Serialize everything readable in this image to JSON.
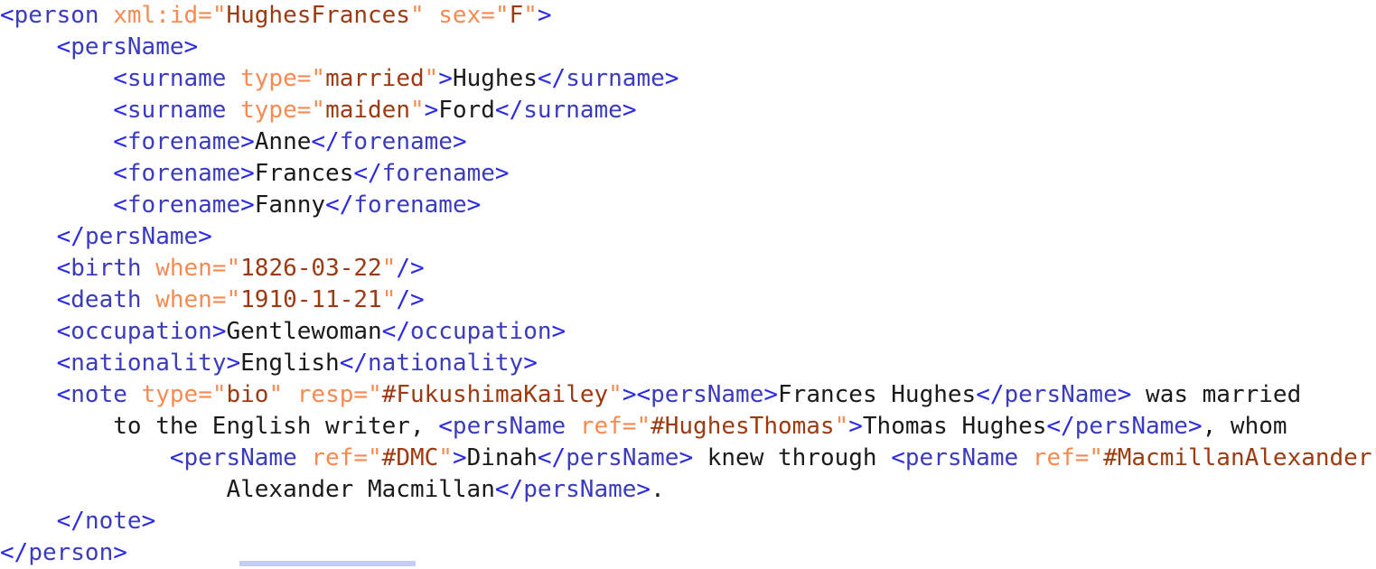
{
  "document": {
    "kind": "xml-source",
    "language": "XML / TEI",
    "root_element": "person",
    "colors": {
      "background": "#ffffff",
      "bracket": "#2a2ae6",
      "element_name": "#3b3bbd",
      "attribute_name": "#f58b52",
      "attribute_value": "#9c3a12",
      "text_content": "#1a1a1a",
      "bottom_bar": "#c5cdf5"
    }
  },
  "record": {
    "xml_id": "HughesFrances",
    "sex": "F",
    "surname_married": "Hughes",
    "surname_maiden": "Ford",
    "forenames": [
      "Anne",
      "Frances",
      "Fanny"
    ],
    "birth_when": "1826-03-22",
    "death_when": "1910-11-21",
    "occupation": "Gentlewoman",
    "nationality": "English",
    "note_type": "bio",
    "note_resp": "#FukushimaKailey",
    "note_refs": [
      "#HughesThomas",
      "#DMC",
      "#MacmillanAlexander"
    ]
  },
  "lines": [
    {
      "id": "line-1",
      "indent": 0,
      "tokens": [
        {
          "t": "tag",
          "v": "<"
        },
        {
          "t": "name",
          "v": "person"
        },
        {
          "t": "text",
          "v": " "
        },
        {
          "t": "attr",
          "v": "xml:id"
        },
        {
          "t": "eq",
          "v": "="
        },
        {
          "t": "quote",
          "v": "\""
        },
        {
          "t": "value",
          "v": "HughesFrances"
        },
        {
          "t": "quote",
          "v": "\""
        },
        {
          "t": "text",
          "v": " "
        },
        {
          "t": "attr",
          "v": "sex"
        },
        {
          "t": "eq",
          "v": "="
        },
        {
          "t": "quote",
          "v": "\""
        },
        {
          "t": "value",
          "v": "F"
        },
        {
          "t": "quote",
          "v": "\""
        },
        {
          "t": "tag",
          "v": ">"
        }
      ]
    },
    {
      "id": "line-2",
      "indent": 1,
      "tokens": [
        {
          "t": "tag",
          "v": "<"
        },
        {
          "t": "name",
          "v": "persName"
        },
        {
          "t": "tag",
          "v": ">"
        }
      ]
    },
    {
      "id": "line-3",
      "indent": 2,
      "tokens": [
        {
          "t": "tag",
          "v": "<"
        },
        {
          "t": "name",
          "v": "surname"
        },
        {
          "t": "text",
          "v": " "
        },
        {
          "t": "attr",
          "v": "type"
        },
        {
          "t": "eq",
          "v": "="
        },
        {
          "t": "quote",
          "v": "\""
        },
        {
          "t": "value",
          "v": "married"
        },
        {
          "t": "quote",
          "v": "\""
        },
        {
          "t": "tag",
          "v": ">"
        },
        {
          "t": "text",
          "v": "Hughes"
        },
        {
          "t": "tag",
          "v": "</"
        },
        {
          "t": "name",
          "v": "surname"
        },
        {
          "t": "tag",
          "v": ">"
        }
      ]
    },
    {
      "id": "line-4",
      "indent": 2,
      "tokens": [
        {
          "t": "tag",
          "v": "<"
        },
        {
          "t": "name",
          "v": "surname"
        },
        {
          "t": "text",
          "v": " "
        },
        {
          "t": "attr",
          "v": "type"
        },
        {
          "t": "eq",
          "v": "="
        },
        {
          "t": "quote",
          "v": "\""
        },
        {
          "t": "value",
          "v": "maiden"
        },
        {
          "t": "quote",
          "v": "\""
        },
        {
          "t": "tag",
          "v": ">"
        },
        {
          "t": "text",
          "v": "Ford"
        },
        {
          "t": "tag",
          "v": "</"
        },
        {
          "t": "name",
          "v": "surname"
        },
        {
          "t": "tag",
          "v": ">"
        }
      ]
    },
    {
      "id": "line-5",
      "indent": 2,
      "tokens": [
        {
          "t": "tag",
          "v": "<"
        },
        {
          "t": "name",
          "v": "forename"
        },
        {
          "t": "tag",
          "v": ">"
        },
        {
          "t": "text",
          "v": "Anne"
        },
        {
          "t": "tag",
          "v": "</"
        },
        {
          "t": "name",
          "v": "forename"
        },
        {
          "t": "tag",
          "v": ">"
        }
      ]
    },
    {
      "id": "line-6",
      "indent": 2,
      "tokens": [
        {
          "t": "tag",
          "v": "<"
        },
        {
          "t": "name",
          "v": "forename"
        },
        {
          "t": "tag",
          "v": ">"
        },
        {
          "t": "text",
          "v": "Frances"
        },
        {
          "t": "tag",
          "v": "</"
        },
        {
          "t": "name",
          "v": "forename"
        },
        {
          "t": "tag",
          "v": ">"
        }
      ]
    },
    {
      "id": "line-7",
      "indent": 2,
      "tokens": [
        {
          "t": "tag",
          "v": "<"
        },
        {
          "t": "name",
          "v": "forename"
        },
        {
          "t": "tag",
          "v": ">"
        },
        {
          "t": "text",
          "v": "Fanny"
        },
        {
          "t": "tag",
          "v": "</"
        },
        {
          "t": "name",
          "v": "forename"
        },
        {
          "t": "tag",
          "v": ">"
        }
      ]
    },
    {
      "id": "line-8",
      "indent": 1,
      "tokens": [
        {
          "t": "tag",
          "v": "</"
        },
        {
          "t": "name",
          "v": "persName"
        },
        {
          "t": "tag",
          "v": ">"
        }
      ]
    },
    {
      "id": "line-9",
      "indent": 1,
      "tokens": [
        {
          "t": "tag",
          "v": "<"
        },
        {
          "t": "name",
          "v": "birth"
        },
        {
          "t": "text",
          "v": " "
        },
        {
          "t": "attr",
          "v": "when"
        },
        {
          "t": "eq",
          "v": "="
        },
        {
          "t": "quote",
          "v": "\""
        },
        {
          "t": "value",
          "v": "1826-03-22"
        },
        {
          "t": "quote",
          "v": "\""
        },
        {
          "t": "tag",
          "v": "/>"
        }
      ]
    },
    {
      "id": "line-10",
      "indent": 1,
      "tokens": [
        {
          "t": "tag",
          "v": "<"
        },
        {
          "t": "name",
          "v": "death"
        },
        {
          "t": "text",
          "v": " "
        },
        {
          "t": "attr",
          "v": "when"
        },
        {
          "t": "eq",
          "v": "="
        },
        {
          "t": "quote",
          "v": "\""
        },
        {
          "t": "value",
          "v": "1910-11-21"
        },
        {
          "t": "quote",
          "v": "\""
        },
        {
          "t": "tag",
          "v": "/>"
        }
      ]
    },
    {
      "id": "line-11",
      "indent": 1,
      "tokens": [
        {
          "t": "tag",
          "v": "<"
        },
        {
          "t": "name",
          "v": "occupation"
        },
        {
          "t": "tag",
          "v": ">"
        },
        {
          "t": "text",
          "v": "Gentlewoman"
        },
        {
          "t": "tag",
          "v": "</"
        },
        {
          "t": "name",
          "v": "occupation"
        },
        {
          "t": "tag",
          "v": ">"
        }
      ]
    },
    {
      "id": "line-12",
      "indent": 1,
      "tokens": [
        {
          "t": "tag",
          "v": "<"
        },
        {
          "t": "name",
          "v": "nationality"
        },
        {
          "t": "tag",
          "v": ">"
        },
        {
          "t": "text",
          "v": "English"
        },
        {
          "t": "tag",
          "v": "</"
        },
        {
          "t": "name",
          "v": "nationality"
        },
        {
          "t": "tag",
          "v": ">"
        }
      ]
    },
    {
      "id": "line-13",
      "indent": 1,
      "tokens": [
        {
          "t": "tag",
          "v": "<"
        },
        {
          "t": "name",
          "v": "note"
        },
        {
          "t": "text",
          "v": " "
        },
        {
          "t": "attr",
          "v": "type"
        },
        {
          "t": "eq",
          "v": "="
        },
        {
          "t": "quote",
          "v": "\""
        },
        {
          "t": "value",
          "v": "bio"
        },
        {
          "t": "quote",
          "v": "\""
        },
        {
          "t": "text",
          "v": " "
        },
        {
          "t": "attr",
          "v": "resp"
        },
        {
          "t": "eq",
          "v": "="
        },
        {
          "t": "quote",
          "v": "\""
        },
        {
          "t": "value",
          "v": "#FukushimaKailey"
        },
        {
          "t": "quote",
          "v": "\""
        },
        {
          "t": "tag",
          "v": ">"
        },
        {
          "t": "tag",
          "v": "<"
        },
        {
          "t": "name",
          "v": "persName"
        },
        {
          "t": "tag",
          "v": ">"
        },
        {
          "t": "text",
          "v": "Frances Hughes"
        },
        {
          "t": "tag",
          "v": "</"
        },
        {
          "t": "name",
          "v": "persName"
        },
        {
          "t": "tag",
          "v": ">"
        },
        {
          "t": "text",
          "v": " was married"
        }
      ]
    },
    {
      "id": "line-14",
      "indent": 2,
      "tokens": [
        {
          "t": "text",
          "v": "to the English writer, "
        },
        {
          "t": "tag",
          "v": "<"
        },
        {
          "t": "name",
          "v": "persName"
        },
        {
          "t": "text",
          "v": " "
        },
        {
          "t": "attr",
          "v": "ref"
        },
        {
          "t": "eq",
          "v": "="
        },
        {
          "t": "quote",
          "v": "\""
        },
        {
          "t": "value",
          "v": "#HughesThomas"
        },
        {
          "t": "quote",
          "v": "\""
        },
        {
          "t": "tag",
          "v": ">"
        },
        {
          "t": "text",
          "v": "Thomas Hughes"
        },
        {
          "t": "tag",
          "v": "</"
        },
        {
          "t": "name",
          "v": "persName"
        },
        {
          "t": "tag",
          "v": ">"
        },
        {
          "t": "text",
          "v": ", whom"
        }
      ]
    },
    {
      "id": "line-15",
      "indent": 3,
      "tokens": [
        {
          "t": "tag",
          "v": "<"
        },
        {
          "t": "name",
          "v": "persName"
        },
        {
          "t": "text",
          "v": " "
        },
        {
          "t": "attr",
          "v": "ref"
        },
        {
          "t": "eq",
          "v": "="
        },
        {
          "t": "quote",
          "v": "\""
        },
        {
          "t": "value",
          "v": "#DMC"
        },
        {
          "t": "quote",
          "v": "\""
        },
        {
          "t": "tag",
          "v": ">"
        },
        {
          "t": "text",
          "v": "Dinah"
        },
        {
          "t": "tag",
          "v": "</"
        },
        {
          "t": "name",
          "v": "persName"
        },
        {
          "t": "tag",
          "v": ">"
        },
        {
          "t": "text",
          "v": " knew through "
        },
        {
          "t": "tag",
          "v": "<"
        },
        {
          "t": "name",
          "v": "persName"
        },
        {
          "t": "text",
          "v": " "
        },
        {
          "t": "attr",
          "v": "ref"
        },
        {
          "t": "eq",
          "v": "="
        },
        {
          "t": "quote",
          "v": "\""
        },
        {
          "t": "value",
          "v": "#MacmillanAlexander"
        },
        {
          "t": "quote",
          "v": "\""
        },
        {
          "t": "tag",
          "v": ">"
        }
      ]
    },
    {
      "id": "line-16",
      "indent": 4,
      "tokens": [
        {
          "t": "text",
          "v": "Alexander Macmillan"
        },
        {
          "t": "tag",
          "v": "</"
        },
        {
          "t": "name",
          "v": "persName"
        },
        {
          "t": "tag",
          "v": ">"
        },
        {
          "t": "text",
          "v": "."
        }
      ]
    },
    {
      "id": "line-17",
      "indent": 1,
      "tokens": [
        {
          "t": "tag",
          "v": "</"
        },
        {
          "t": "name",
          "v": "note"
        },
        {
          "t": "tag",
          "v": ">"
        }
      ]
    },
    {
      "id": "line-18",
      "indent": 0,
      "tokens": [
        {
          "t": "tag",
          "v": "</"
        },
        {
          "t": "name",
          "v": "person"
        },
        {
          "t": "tag",
          "v": ">"
        }
      ]
    }
  ]
}
